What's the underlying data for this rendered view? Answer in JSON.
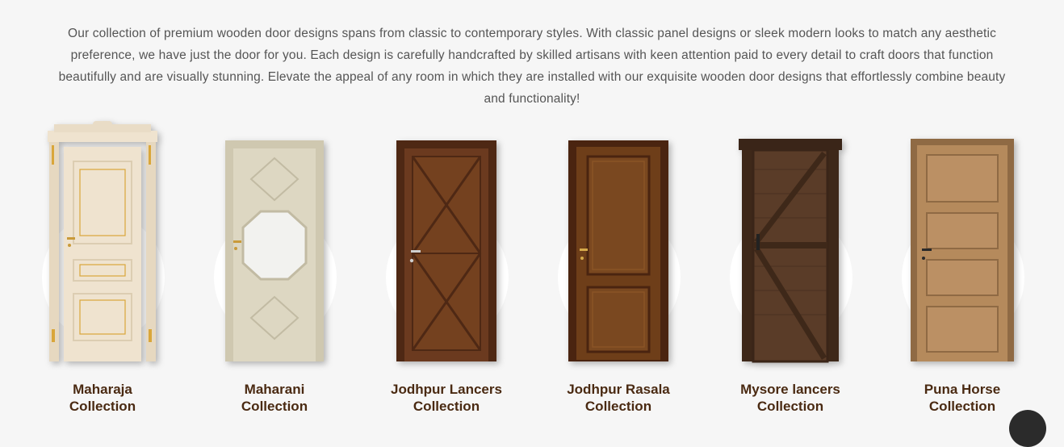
{
  "intro": "Our collection of premium wooden door designs spans from classic to contemporary styles. With classic panel designs or sleek modern looks to match any aesthetic preference, we have just the door for you. Each design is carefully handcrafted by skilled artisans with keen attention paid to every detail to craft doors that function beautifully and are visually stunning. Elevate the appeal of any room in which they are installed with our exquisite wooden door designs that effortlessly combine beauty and functionality!",
  "collections": [
    {
      "line1": "Maharaja",
      "line2": "Collection",
      "door_color": "#efe3cf",
      "trim_color": "#d9a63a"
    },
    {
      "line1": "Maharani",
      "line2": "Collection",
      "door_color": "#d9d3bd",
      "trim_color": "#bfb79d"
    },
    {
      "line1": "Jodhpur Lancers",
      "line2": "Collection",
      "door_color": "#6b3a1f",
      "trim_color": "#4e2814"
    },
    {
      "line1": "Jodhpur Rasala",
      "line2": "Collection",
      "door_color": "#6e3e19",
      "trim_color": "#4a2410"
    },
    {
      "line1": "Mysore lancers",
      "line2": "Collection",
      "door_color": "#4e3424",
      "trim_color": "#3a2518"
    },
    {
      "line1": "Puna Horse",
      "line2": "Collection",
      "door_color": "#b58a5c",
      "trim_color": "#8f6a44"
    }
  ],
  "caption_color": "#4a2a12"
}
